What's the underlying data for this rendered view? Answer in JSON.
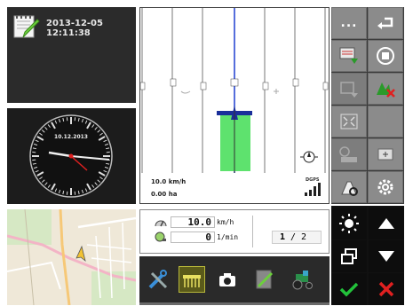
{
  "note": {
    "datetime": "2013-12-05 12:11:38",
    "icon": "note-pen-icon"
  },
  "clock": {
    "date": "10.12.2013"
  },
  "guidance": {
    "speed": "10.0 km/h",
    "area": "0.00 ha",
    "signal_label": "DGPS"
  },
  "softkeys": {
    "more_label": "...",
    "items": [
      {
        "icon": "more-icon"
      },
      {
        "icon": "back-icon"
      },
      {
        "icon": "field-export-icon"
      },
      {
        "icon": "stop-icon"
      },
      {
        "icon": "headland-icon"
      },
      {
        "icon": "track-delete-icon"
      },
      {
        "icon": "fullscreen-icon"
      },
      {
        "icon": "blank"
      },
      {
        "icon": "sections-icon"
      },
      {
        "icon": "zoom-icon"
      },
      {
        "icon": "settings-wrench-icon"
      },
      {
        "icon": "gear-icon"
      }
    ]
  },
  "counters": {
    "speed_value": "10.0",
    "speed_unit": "km/h",
    "rpm_value": "0",
    "rpm_unit": "1/min",
    "page": "1",
    "pages": "2"
  },
  "appbar": {
    "items": [
      "tools-icon",
      "implement-icon",
      "camera-icon",
      "map-icon",
      "tractor-icon"
    ]
  },
  "controls": {
    "items": [
      "brightness-icon",
      "window-switch-icon",
      "confirm-icon",
      "arrow-up-icon",
      "arrow-down-icon",
      "cancel-icon"
    ]
  },
  "colors": {
    "accent_green": "#5ee26e",
    "guide_line": "#1f3fd0",
    "ok": "#22c23a",
    "cancel": "#e02020"
  }
}
